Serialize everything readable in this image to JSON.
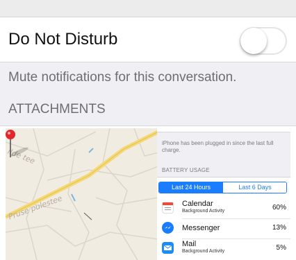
{
  "settings": {
    "dnd_label": "Do Not Disturb",
    "dnd_toggle_on": false,
    "mute_text": "Mute notifications for this conversation.",
    "attachments_header": "ATTACHMENTS"
  },
  "map_thumbnail": {
    "street_labels": [
      "ilde tee",
      "Pruse pulestee"
    ],
    "icon": "map-pin-icon"
  },
  "battery_screenshot": {
    "plug_note": "iPhone has been plugged in since the last full charge.",
    "usage_header": "BATTERY USAGE",
    "tabs": [
      "Last 24 Hours",
      "Last 6 Days"
    ],
    "selected_tab": "Last 24 Hours",
    "apps": [
      {
        "name": "Calendar",
        "sub": "Background Activity",
        "percent": "60%",
        "icon": "calendar-icon",
        "color": "#e84c3d"
      },
      {
        "name": "Messenger",
        "sub": "",
        "percent": "13%",
        "icon": "messenger-icon",
        "color": "#1a7dff"
      },
      {
        "name": "Mail",
        "sub": "Background Activity",
        "percent": "5%",
        "icon": "mail-icon",
        "color": "#1d8cf8"
      }
    ]
  },
  "colors": {
    "ios_blue": "#1a7dff",
    "group_background": "#efeff4",
    "secondary_text": "#6d6d72"
  }
}
